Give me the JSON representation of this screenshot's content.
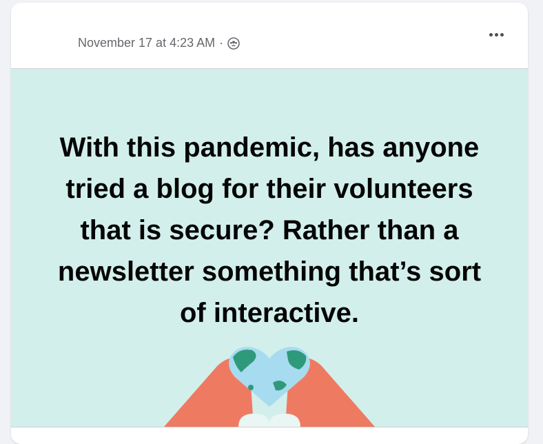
{
  "post": {
    "timestamp": "November 17 at 4:23 AM",
    "separator": "·",
    "audience_icon": "group-icon",
    "more_icon": "more-horizontal-icon",
    "body_text": "With this pandemic, has anyone tried a blog for their volunteers that is secure? Rather than a newsletter something that’s sort of interactive.",
    "background_color": "#d2efeb",
    "graphic": "heart-hands-globe"
  },
  "colors": {
    "hands": "#ef7a62",
    "globe_water": "#a7dbef",
    "globe_land": "#2e9a7b",
    "heart_light": "#eaf6f4"
  }
}
